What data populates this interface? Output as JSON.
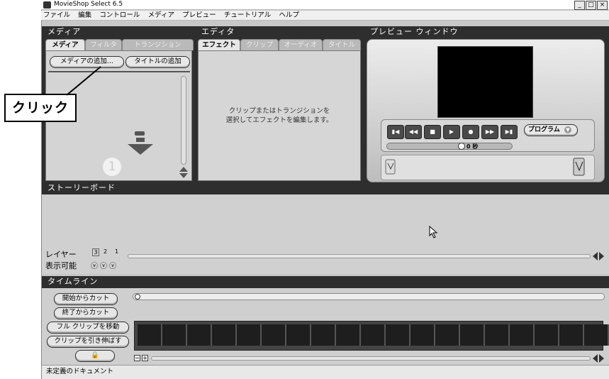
{
  "window": {
    "title": "MovieShop Select 6.5",
    "min": "_",
    "max": "□",
    "close": "×"
  },
  "menu": [
    "ファイル",
    "編集",
    "コントロール",
    "メディア",
    "プレビュー",
    "チュートリアル",
    "ヘルプ"
  ],
  "media": {
    "header": "メディア",
    "tabs": [
      "メディア",
      "フィルタ",
      "トランジション"
    ],
    "add_media": "メディアの追加...",
    "add_title": "タイトルの追加",
    "step_number": "1"
  },
  "editor": {
    "header": "エディタ",
    "tabs": [
      "エフェクト",
      "クリップ",
      "オーディオ",
      "タイトル"
    ],
    "hint_line1": "クリップまたはトランジションを",
    "hint_line2": "選択してエフェクトを編集します。"
  },
  "preview": {
    "header": "プレビュー ウィンドウ",
    "mode": "プログラム",
    "time": "0 秒"
  },
  "storyboard": {
    "header": "ストーリーボード",
    "layer_label": "レイヤー",
    "layers": [
      "3",
      "2",
      "1"
    ],
    "visible_label": "表示可能"
  },
  "timeline": {
    "header": "タイムライン",
    "buttons": [
      "開始からカット",
      "終了からカット",
      "フル クリップを移動",
      "クリップを引き伸ばす"
    ]
  },
  "status": "未定義のドキュメント",
  "callout": "クリック"
}
